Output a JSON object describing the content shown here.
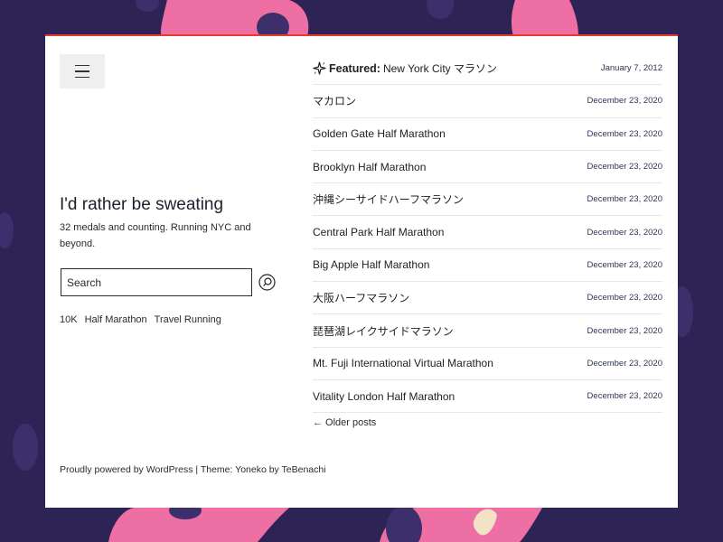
{
  "site": {
    "title": "I'd rather be sweating",
    "description": "32 medals and counting. Running NYC and beyond."
  },
  "search": {
    "placeholder": "Search"
  },
  "tags": [
    "10K",
    "Half Marathon",
    "Travel Running"
  ],
  "featured": {
    "label": "Featured:",
    "title": "New York City マラソン",
    "date": "January 7, 2012"
  },
  "posts": [
    {
      "title": "マカロン",
      "date": "December 23, 2020"
    },
    {
      "title": "Golden Gate Half Marathon",
      "date": "December 23, 2020"
    },
    {
      "title": "Brooklyn Half Marathon",
      "date": "December 23, 2020"
    },
    {
      "title": "沖縄シーサイドハーフマラソン",
      "date": "December 23, 2020"
    },
    {
      "title": "Central Park Half Marathon",
      "date": "December 23, 2020"
    },
    {
      "title": "Big Apple Half Marathon",
      "date": "December 23, 2020"
    },
    {
      "title": "大阪ハーフマラソン",
      "date": "December 23, 2020"
    },
    {
      "title": "琵琶湖レイクサイドマラソン",
      "date": "December 23, 2020"
    },
    {
      "title": "Mt. Fuji International Virtual Marathon",
      "date": "December 23, 2020"
    },
    {
      "title": "Vitality London Half Marathon",
      "date": "December 23, 2020"
    }
  ],
  "pagination": {
    "older_label": "← Older posts"
  },
  "footer": {
    "text": "Proudly powered by WordPress | Theme: Yoneko by TeBenachi"
  },
  "colors": {
    "background": "#2d2455",
    "blob_pink": "#ee6fa3",
    "blob_dark": "#3c2f6b",
    "accent_border": "#e8382f"
  }
}
